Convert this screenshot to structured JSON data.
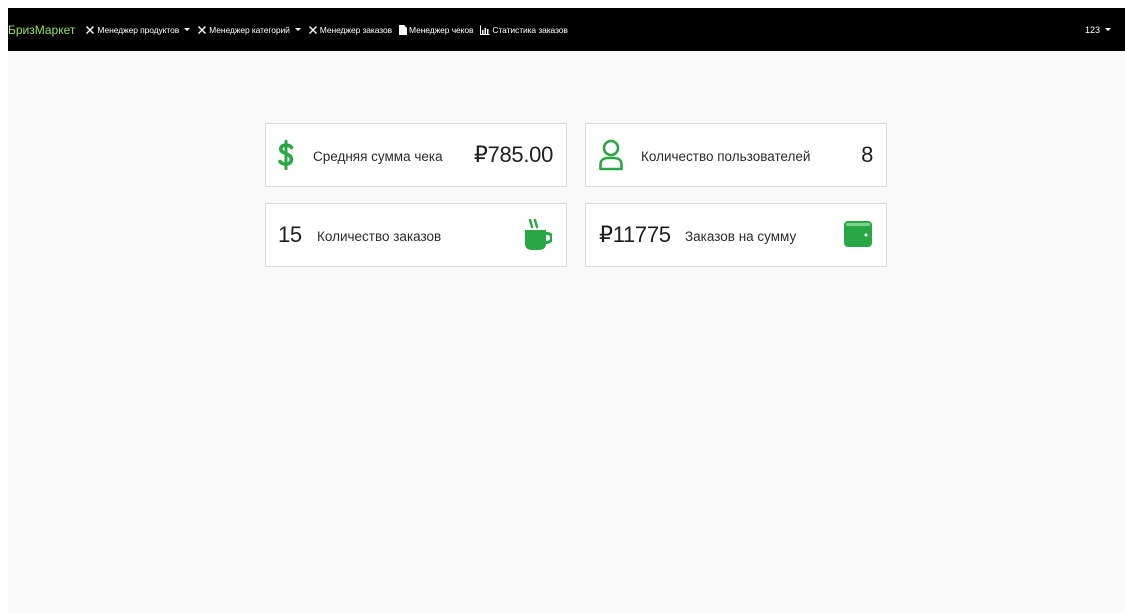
{
  "navbar": {
    "brand": "БризМаркет",
    "items": [
      {
        "label": "Менеджер продуктов",
        "icon": "tools-icon",
        "dropdown": true
      },
      {
        "label": "Менеджер категорий",
        "icon": "tools-icon",
        "dropdown": true
      },
      {
        "label": "Менеджер заказов",
        "icon": "tools-icon",
        "dropdown": false
      },
      {
        "label": "Менеджер чеков",
        "icon": "file-icon",
        "dropdown": false
      },
      {
        "label": "Статистика заказов",
        "icon": "chart-icon",
        "dropdown": false
      }
    ],
    "user": "123"
  },
  "stats": {
    "avg_check": {
      "label": "Средняя сумма чека",
      "value": "₽785.00",
      "icon": "dollar-icon"
    },
    "users_count": {
      "label": "Количество пользователей",
      "value": "8",
      "icon": "user-icon"
    },
    "orders_count": {
      "label": "Количество заказов",
      "value": "15",
      "icon": "coffee-icon"
    },
    "orders_sum": {
      "label": "Заказов на сумму",
      "value": "₽11775",
      "icon": "wallet-icon"
    }
  },
  "colors": {
    "accent": "#28a745",
    "navbar_bg": "#000000",
    "brand": "#9be05a",
    "page_bg": "#f9f9f9"
  }
}
